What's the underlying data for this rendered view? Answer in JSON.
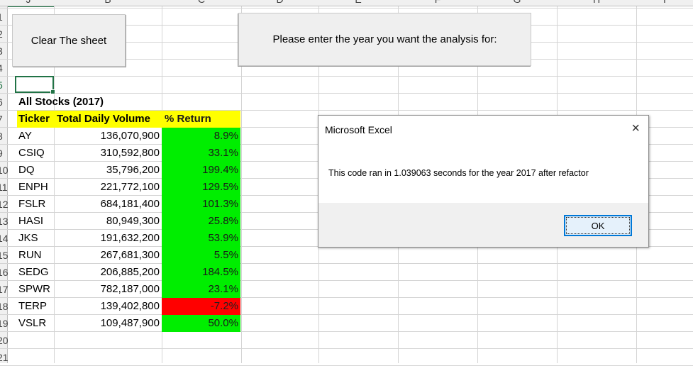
{
  "columns": [
    "A",
    "B",
    "C",
    "D",
    "E",
    "F",
    "G",
    "H",
    "I",
    "J"
  ],
  "rows": [
    "1",
    "2",
    "3",
    "4",
    "5",
    "6",
    "7",
    "8",
    "9",
    "10",
    "11",
    "12",
    "13",
    "14",
    "15",
    "16",
    "17",
    "18",
    "19",
    "20",
    "21"
  ],
  "buttons": {
    "clear_sheet": "Clear The sheet",
    "enter_year": "Please enter the year you want the analysis for:"
  },
  "table": {
    "title": "All Stocks (2017)",
    "headers": [
      "Ticker",
      "Total Daily Volume",
      "% Return"
    ],
    "rows": [
      {
        "ticker": "AY",
        "volume": "136,070,900",
        "ret": "8.9%",
        "status": "positive"
      },
      {
        "ticker": "CSIQ",
        "volume": "310,592,800",
        "ret": "33.1%",
        "status": "positive"
      },
      {
        "ticker": "DQ",
        "volume": "35,796,200",
        "ret": "199.4%",
        "status": "positive"
      },
      {
        "ticker": "ENPH",
        "volume": "221,772,100",
        "ret": "129.5%",
        "status": "positive"
      },
      {
        "ticker": "FSLR",
        "volume": "684,181,400",
        "ret": "101.3%",
        "status": "positive"
      },
      {
        "ticker": "HASI",
        "volume": "80,949,300",
        "ret": "25.8%",
        "status": "positive"
      },
      {
        "ticker": "JKS",
        "volume": "191,632,200",
        "ret": "53.9%",
        "status": "positive"
      },
      {
        "ticker": "RUN",
        "volume": "267,681,300",
        "ret": "5.5%",
        "status": "positive"
      },
      {
        "ticker": "SEDG",
        "volume": "206,885,200",
        "ret": "184.5%",
        "status": "positive"
      },
      {
        "ticker": "SPWR",
        "volume": "782,187,000",
        "ret": "23.1%",
        "status": "positive"
      },
      {
        "ticker": "TERP",
        "volume": "139,402,800",
        "ret": "-7.2%",
        "status": "negative"
      },
      {
        "ticker": "VSLR",
        "volume": "109,487,900",
        "ret": "50.0%",
        "status": "positive"
      }
    ]
  },
  "dialog": {
    "title": "Microsoft Excel",
    "message": "This code ran in 1.039063 seconds for the year 2017 after refactor",
    "ok_label": "OK",
    "close_glyph": "×"
  },
  "colors": {
    "positive": "#00ee00",
    "negative": "#ff0000",
    "header_fill": "#ffff00",
    "selection": "#217346"
  }
}
